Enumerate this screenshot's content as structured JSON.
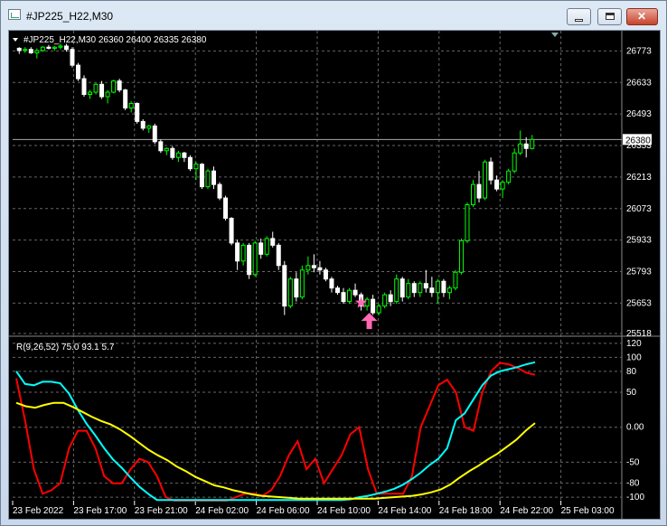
{
  "window": {
    "title": "#JP225_H22,M30"
  },
  "main_chart": {
    "symbol": "#JP225_H22,M30",
    "ohlc": "26360 26400 26335 26380",
    "current_price_label": "26380",
    "y_ticks": [
      "26773",
      "26633",
      "26493",
      "26353",
      "26213",
      "26073",
      "25933",
      "25793",
      "25653",
      "25518"
    ],
    "x_ticks": [
      "23 Feb 2022",
      "23 Feb 17:00",
      "23 Feb 21:00",
      "24 Feb 02:00",
      "24 Feb 06:00",
      "24 Feb 10:00",
      "24 Feb 14:00",
      "24 Feb 18:00",
      "24 Feb 22:00",
      "25 Feb 03:00"
    ]
  },
  "indicator": {
    "label": "R(9,26,52) 75.0 93.1 5.7",
    "y_ticks": [
      "120",
      "100",
      "80",
      "50",
      "0.00",
      "-50",
      "-80",
      "-100"
    ]
  },
  "colors": {
    "background": "#000000",
    "bull": "#00ff00",
    "bear": "#ffffff",
    "red_line": "#ff0000",
    "cyan_line": "#00ffff",
    "yellow_line": "#ffff00",
    "star": "#ff69b4",
    "arrow": "#ff69b4"
  },
  "chart_data": [
    {
      "type": "candlestick",
      "title": "#JP225_H22,M30",
      "ylim": [
        25518,
        26843
      ],
      "candles": [
        [
          26785,
          26790,
          26760,
          26775
        ],
        [
          26775,
          26790,
          26765,
          26780
        ],
        [
          26780,
          26790,
          26760,
          26765
        ],
        [
          26765,
          26785,
          26740,
          26775
        ],
        [
          26775,
          26795,
          26770,
          26790
        ],
        [
          26790,
          26800,
          26780,
          26785
        ],
        [
          26785,
          26795,
          26775,
          26790
        ],
        [
          26790,
          26805,
          26780,
          26795
        ],
        [
          26795,
          26805,
          26770,
          26780
        ],
        [
          26780,
          26790,
          26700,
          26710
        ],
        [
          26710,
          26720,
          26640,
          26650
        ],
        [
          26650,
          26665,
          26570,
          26580
        ],
        [
          26580,
          26600,
          26560,
          26590
        ],
        [
          26590,
          26630,
          26580,
          26625
        ],
        [
          26625,
          26640,
          26560,
          26570
        ],
        [
          26570,
          26600,
          26540,
          26590
        ],
        [
          26590,
          26645,
          26585,
          26640
        ],
        [
          26640,
          26650,
          26590,
          26600
        ],
        [
          26600,
          26605,
          26510,
          26520
        ],
        [
          26520,
          26550,
          26500,
          26540
        ],
        [
          26540,
          26545,
          26450,
          26460
        ],
        [
          26460,
          26470,
          26420,
          26430
        ],
        [
          26430,
          26445,
          26410,
          26440
        ],
        [
          26440,
          26450,
          26360,
          26370
        ],
        [
          26370,
          26380,
          26320,
          26330
        ],
        [
          26330,
          26345,
          26310,
          26340
        ],
        [
          26340,
          26350,
          26290,
          26300
        ],
        [
          26300,
          26330,
          26280,
          26320
        ],
        [
          26320,
          26325,
          26280,
          26300
        ],
        [
          26300,
          26310,
          26240,
          26250
        ],
        [
          26250,
          26280,
          26200,
          26270
        ],
        [
          26270,
          26275,
          26160,
          26170
        ],
        [
          26170,
          26250,
          26160,
          26240
        ],
        [
          26240,
          26260,
          26160,
          26180
        ],
        [
          26180,
          26190,
          26110,
          26120
        ],
        [
          26120,
          26130,
          26020,
          26030
        ],
        [
          26030,
          26035,
          25910,
          25920
        ],
        [
          25920,
          25935,
          25800,
          25840
        ],
        [
          25840,
          25920,
          25820,
          25910
        ],
        [
          25910,
          25920,
          25760,
          25780
        ],
        [
          25780,
          25930,
          25770,
          25920
        ],
        [
          25920,
          25940,
          25850,
          25870
        ],
        [
          25870,
          25950,
          25860,
          25940
        ],
        [
          25940,
          25970,
          25900,
          25910
        ],
        [
          25910,
          25920,
          25800,
          25820
        ],
        [
          25820,
          25840,
          25600,
          25640
        ],
        [
          25640,
          25770,
          25630,
          25760
        ],
        [
          25760,
          25790,
          25660,
          25680
        ],
        [
          25680,
          25820,
          25670,
          25800
        ],
        [
          25800,
          25860,
          25780,
          25820
        ],
        [
          25820,
          25870,
          25790,
          25810
        ],
        [
          25810,
          25840,
          25780,
          25800
        ],
        [
          25800,
          25810,
          25750,
          25760
        ],
        [
          25760,
          25770,
          25700,
          25720
        ],
        [
          25720,
          25730,
          25690,
          25700
        ],
        [
          25700,
          25720,
          25650,
          25660
        ],
        [
          25660,
          25720,
          25650,
          25710
        ],
        [
          25710,
          25740,
          25680,
          25690
        ],
        [
          25690,
          25700,
          25620,
          25640
        ],
        [
          25640,
          25680,
          25620,
          25670
        ],
        [
          25670,
          25690,
          25600,
          25610
        ],
        [
          25610,
          25650,
          25600,
          25640
        ],
        [
          25640,
          25700,
          25630,
          25690
        ],
        [
          25690,
          25710,
          25640,
          25660
        ],
        [
          25660,
          25780,
          25650,
          25760
        ],
        [
          25760,
          25770,
          25660,
          25680
        ],
        [
          25680,
          25760,
          25670,
          25740
        ],
        [
          25740,
          25750,
          25680,
          25700
        ],
        [
          25700,
          25750,
          25680,
          25740
        ],
        [
          25740,
          25800,
          25700,
          25720
        ],
        [
          25720,
          25770,
          25680,
          25700
        ],
        [
          25700,
          25760,
          25650,
          25750
        ],
        [
          25750,
          25760,
          25680,
          25700
        ],
        [
          25700,
          25730,
          25670,
          25720
        ],
        [
          25720,
          25800,
          25710,
          25790
        ],
        [
          25790,
          25940,
          25780,
          25930
        ],
        [
          25930,
          26100,
          25920,
          26090
        ],
        [
          26090,
          26200,
          26080,
          26180
        ],
        [
          26180,
          26240,
          26100,
          26120
        ],
        [
          26120,
          26290,
          26110,
          26280
        ],
        [
          26280,
          26300,
          26180,
          26200
        ],
        [
          26200,
          26220,
          26150,
          26160
        ],
        [
          26160,
          26200,
          26120,
          26190
        ],
        [
          26190,
          26250,
          26180,
          26240
        ],
        [
          26240,
          26340,
          26230,
          26320
        ],
        [
          26320,
          26420,
          26310,
          26360
        ],
        [
          26360,
          26390,
          26300,
          26340
        ],
        [
          26340,
          26400,
          26335,
          26380
        ]
      ]
    },
    {
      "type": "line",
      "title": "R(9,26,52)",
      "ylim": [
        -105,
        125
      ],
      "series": [
        {
          "name": "",
          "values": [
            70,
            10,
            -60,
            -95,
            -90,
            -80,
            -30,
            -5,
            -5,
            -30,
            -70,
            -80,
            -80,
            -60,
            -45,
            -50,
            -70,
            -100,
            -105,
            -105,
            -105,
            -105,
            -105,
            -105,
            -105,
            -100,
            -95,
            -95,
            -98,
            -90,
            -70,
            -40,
            -20,
            -60,
            -45,
            -80,
            -60,
            -40,
            -10,
            0,
            -60,
            -95,
            -95,
            -95,
            -95,
            -70,
            0,
            30,
            60,
            68,
            50,
            0,
            -5,
            50,
            80,
            92,
            90,
            85,
            78,
            75
          ]
        },
        {
          "name": "",
          "values": [
            80,
            62,
            60,
            65,
            65,
            63,
            48,
            25,
            5,
            -12,
            -30,
            -46,
            -58,
            -72,
            -85,
            -95,
            -104,
            -104,
            -104,
            -104,
            -104,
            -104,
            -104,
            -104,
            -104,
            -104,
            -104,
            -104,
            -104,
            -104,
            -104,
            -104,
            -104,
            -104,
            -104,
            -104,
            -104,
            -104,
            -103,
            -100,
            -98,
            -95,
            -92,
            -88,
            -82,
            -74,
            -65,
            -54,
            -45,
            -30,
            10,
            20,
            40,
            60,
            74,
            80,
            83,
            86,
            90,
            93
          ]
        },
        {
          "name": "",
          "values": [
            35,
            30,
            28,
            32,
            35,
            35,
            29,
            22,
            15,
            9,
            4,
            -3,
            -12,
            -22,
            -32,
            -40,
            -47,
            -56,
            -63,
            -71,
            -77,
            -83,
            -86,
            -90,
            -93,
            -96,
            -98,
            -99,
            -100,
            -101,
            -102,
            -102,
            -102,
            -102,
            -102,
            -102,
            -102,
            -102,
            -102,
            -101,
            -100,
            -99,
            -98,
            -96,
            -93,
            -89,
            -82,
            -72,
            -63,
            -55,
            -46,
            -38,
            -28,
            -18,
            -5,
            6
          ]
        }
      ]
    }
  ]
}
